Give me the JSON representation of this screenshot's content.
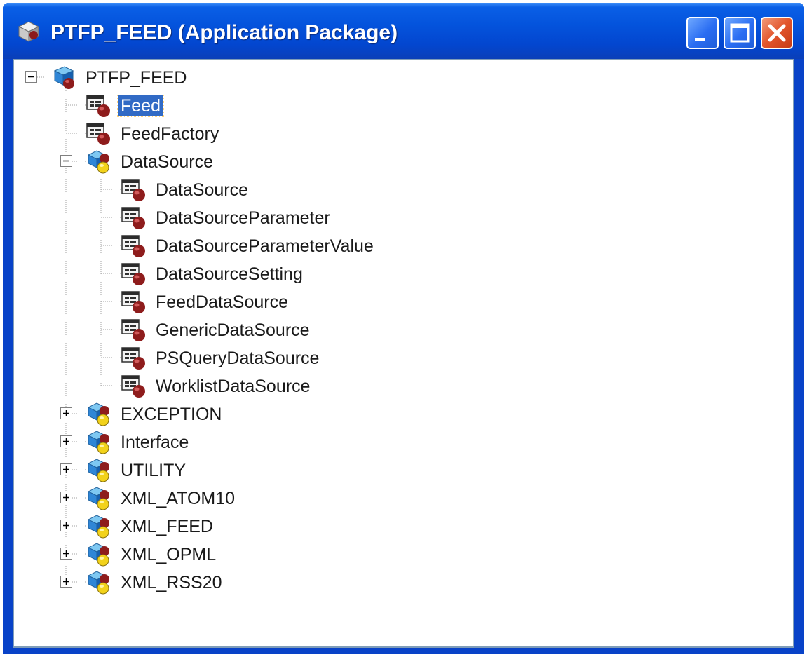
{
  "window": {
    "title": "PTFP_FEED (Application Package)",
    "colors": {
      "title_bar": "#0453dc",
      "selection": "#316ac5",
      "close_button": "#e2542b"
    }
  },
  "tree": {
    "root": {
      "label": "PTFP_FEED",
      "icon": "package-icon",
      "expanded": true
    },
    "classes": [
      {
        "label": "Feed",
        "icon": "class-icon",
        "selected": true
      },
      {
        "label": "FeedFactory",
        "icon": "class-icon"
      }
    ],
    "datasource_package": {
      "label": "DataSource",
      "icon": "subpackage-icon",
      "expanded": true,
      "children": [
        {
          "label": "DataSource"
        },
        {
          "label": "DataSourceParameter"
        },
        {
          "label": "DataSourceParameterValue"
        },
        {
          "label": "DataSourceSetting"
        },
        {
          "label": "FeedDataSource"
        },
        {
          "label": "GenericDataSource"
        },
        {
          "label": "PSQueryDataSource"
        },
        {
          "label": "WorklistDataSource"
        }
      ]
    },
    "collapsed_packages": [
      {
        "label": "EXCEPTION"
      },
      {
        "label": "Interface"
      },
      {
        "label": "UTILITY"
      },
      {
        "label": "XML_ATOM10"
      },
      {
        "label": "XML_FEED"
      },
      {
        "label": "XML_OPML"
      },
      {
        "label": "XML_RSS20"
      }
    ]
  }
}
